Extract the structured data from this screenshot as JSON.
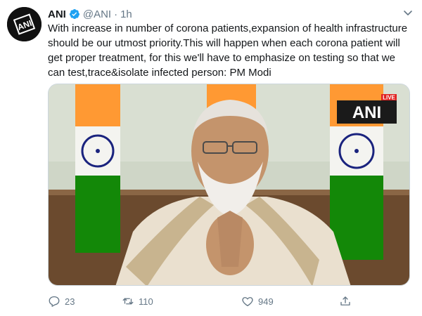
{
  "tweet": {
    "author_name": "ANI",
    "handle": "@ANI",
    "separator": "·",
    "time": "1h",
    "text": "With increase in number of corona patients,expansion of health infrastructure should be our utmost priority.This will happen when each corona patient will get proper treatment, for this we'll have to emphasize on testing so that we can test,trace&isolate infected person: PM Modi",
    "media": {
      "live_label": "LIVE",
      "logo_text": "ANI"
    },
    "stats": {
      "replies": "23",
      "retweets": "110",
      "likes": "949"
    }
  },
  "colors": {
    "verified": "#1da1f2",
    "muted": "#657786",
    "flag_saffron": "#ff9933",
    "flag_green": "#138808",
    "live_red": "#e02020"
  },
  "icons": {
    "caret": "chevron-down-icon",
    "reply": "reply-icon",
    "retweet": "retweet-icon",
    "like": "heart-icon",
    "share": "share-icon",
    "verified": "verified-badge-icon"
  }
}
